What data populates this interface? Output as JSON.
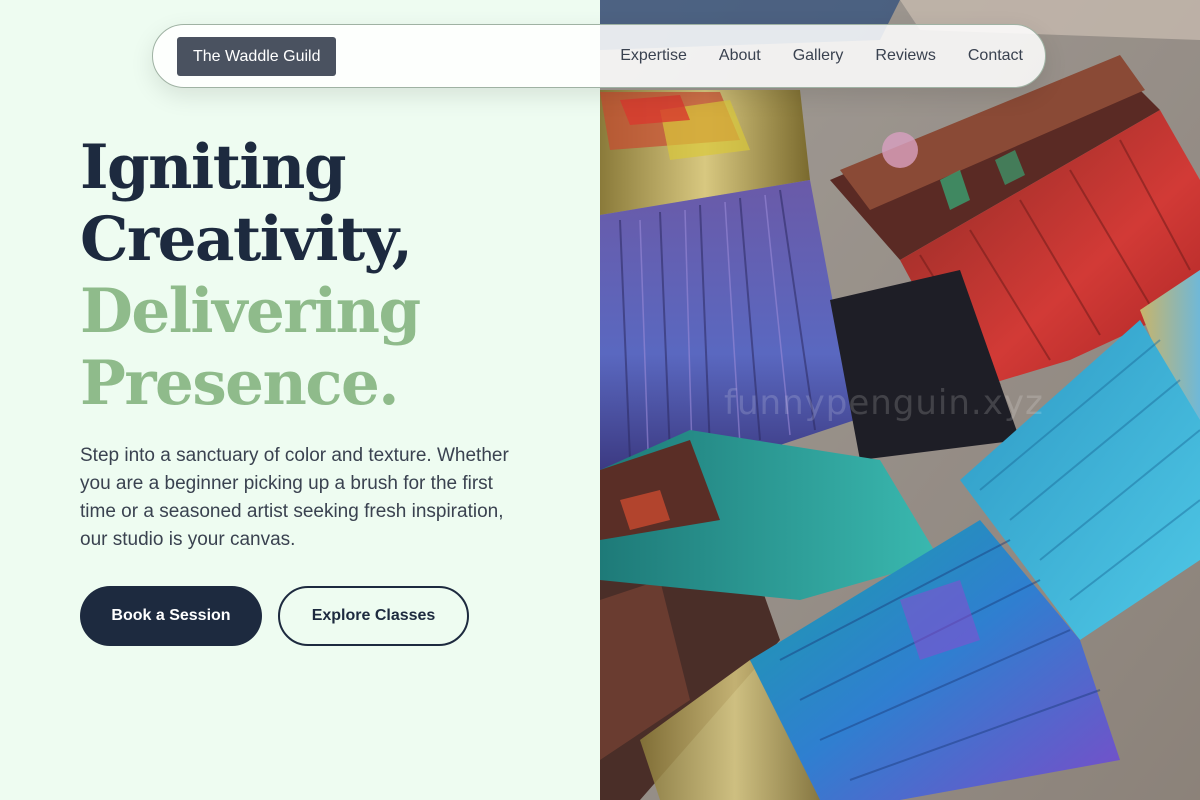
{
  "nav": {
    "brand": "The Waddle Guild",
    "links": [
      "Expertise",
      "About",
      "Gallery",
      "Reviews",
      "Contact"
    ]
  },
  "hero": {
    "headline_dark_1": "Igniting",
    "headline_dark_2": "Creativity,",
    "headline_accent_1": "Delivering",
    "headline_accent_2": "Presence.",
    "lead": "Step into a sanctuary of color and texture. Whether you are a beginner picking up a brush for the first time or a seasoned artist seeking fresh inspiration, our studio is your canvas.",
    "primary_cta": "Book a Session",
    "secondary_cta": "Explore Classes",
    "image_watermark": "funnypenguin.xyz"
  },
  "colors": {
    "page_background": "#eefcf1",
    "ink": "#1d2a3f",
    "accent_green": "#8fbb8b",
    "brand_chip": "#4a5260"
  }
}
